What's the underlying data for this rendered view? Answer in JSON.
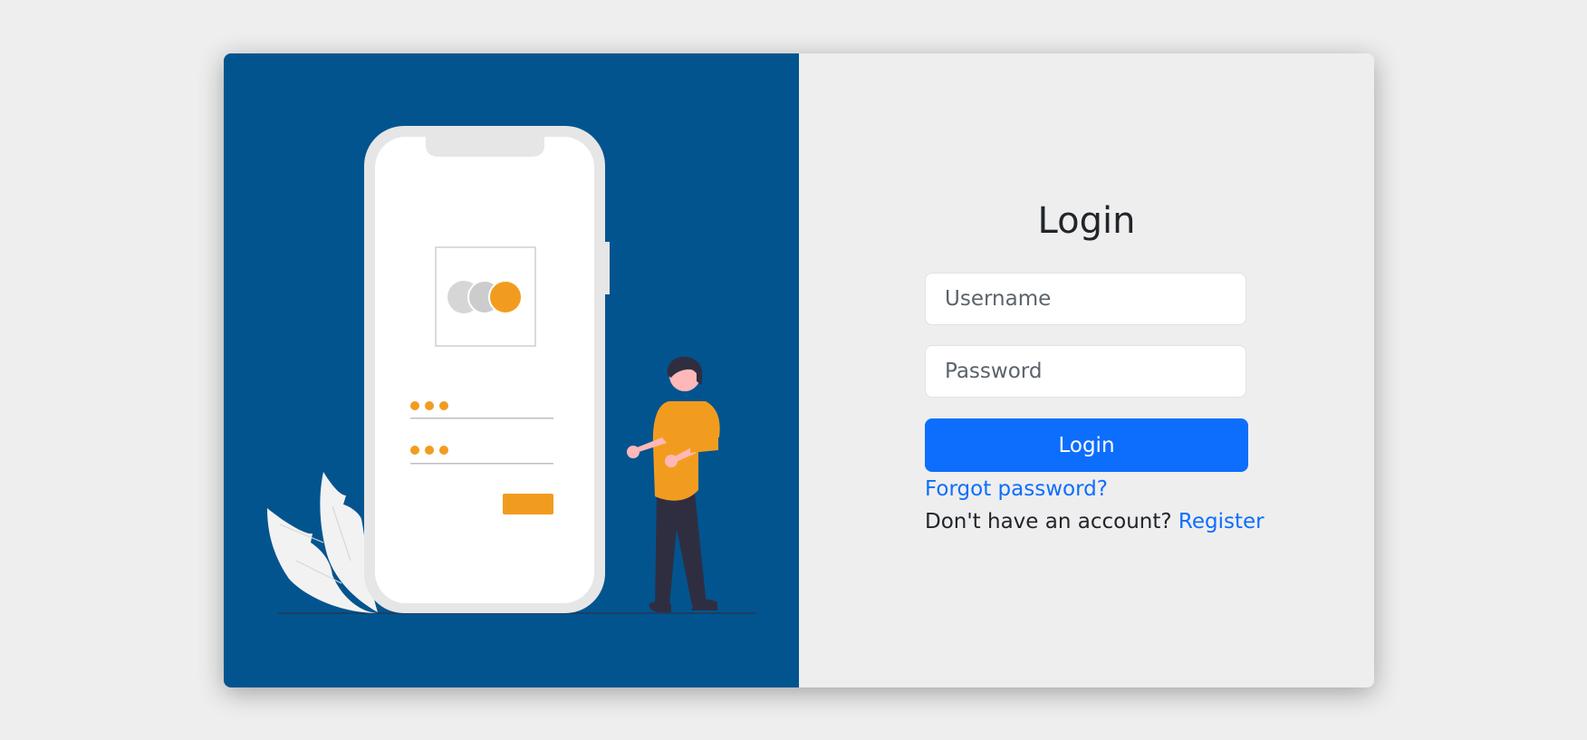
{
  "colors": {
    "page_background": "#eeeeee",
    "illustration_background": "#02548f",
    "accent_orange": "#f29c1f",
    "primary_button": "#0d6efd",
    "link": "#0d6efd"
  },
  "illustration": {
    "name": "person-with-phone-login-illustration"
  },
  "login_form": {
    "title": "Login",
    "username_placeholder": "Username",
    "username_value": "",
    "password_placeholder": "Password",
    "password_value": "",
    "submit_label": "Login",
    "forgot_password_label": "Forgot password?",
    "no_account_text": "Don't have an account?",
    "register_label": "Register"
  }
}
